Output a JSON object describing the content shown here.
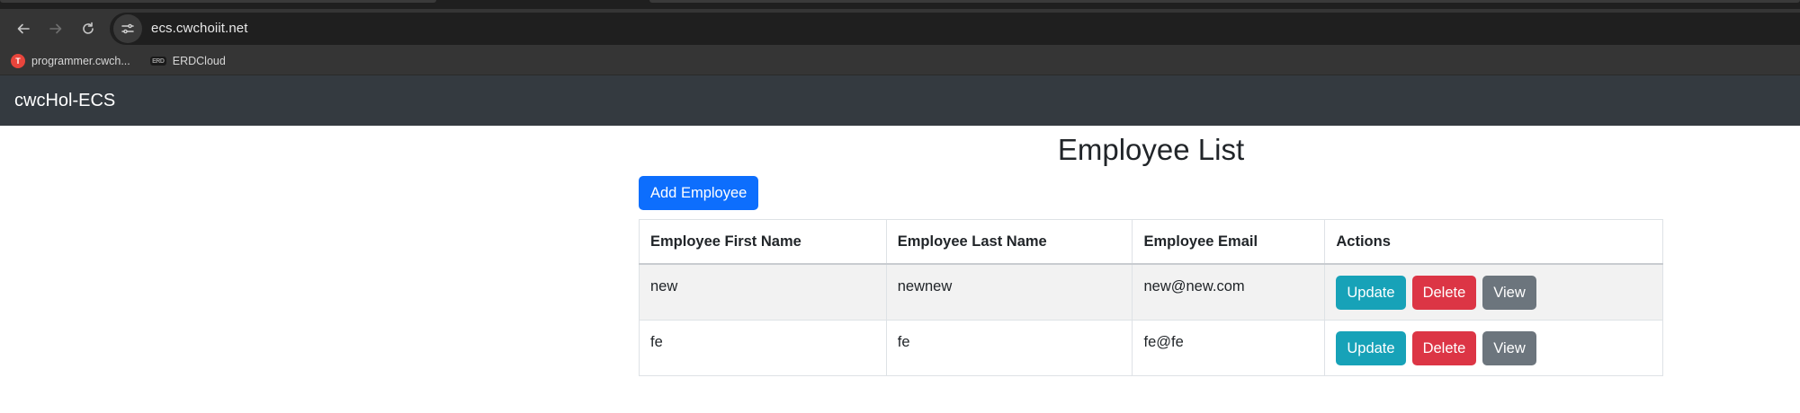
{
  "browser": {
    "url": "ecs.cwchoiit.net",
    "bookmarks": [
      {
        "label": "programmer.cwch...",
        "icon": "t-favicon-icon",
        "icon_text": "T"
      },
      {
        "label": "ERDCloud",
        "icon": "erdcloud-favicon-icon",
        "icon_text": "ERD"
      }
    ]
  },
  "app": {
    "brand": "cwcHol-ECS"
  },
  "page": {
    "title": "Employee List",
    "add_button": "Add Employee"
  },
  "table": {
    "headers": [
      "Employee First Name",
      "Employee Last Name",
      "Employee Email",
      "Actions"
    ],
    "rows": [
      {
        "first": "new",
        "last": "newnew",
        "email": "new@new.com"
      },
      {
        "first": "fe",
        "last": "fe",
        "email": "fe@fe"
      }
    ],
    "actions": {
      "update": "Update",
      "delete": "Delete",
      "view": "View"
    }
  },
  "colors": {
    "primary": "#0d6efd",
    "info": "#17a2b8",
    "danger": "#dc3545",
    "secondary": "#6c757d",
    "navbar": "#343a40"
  }
}
